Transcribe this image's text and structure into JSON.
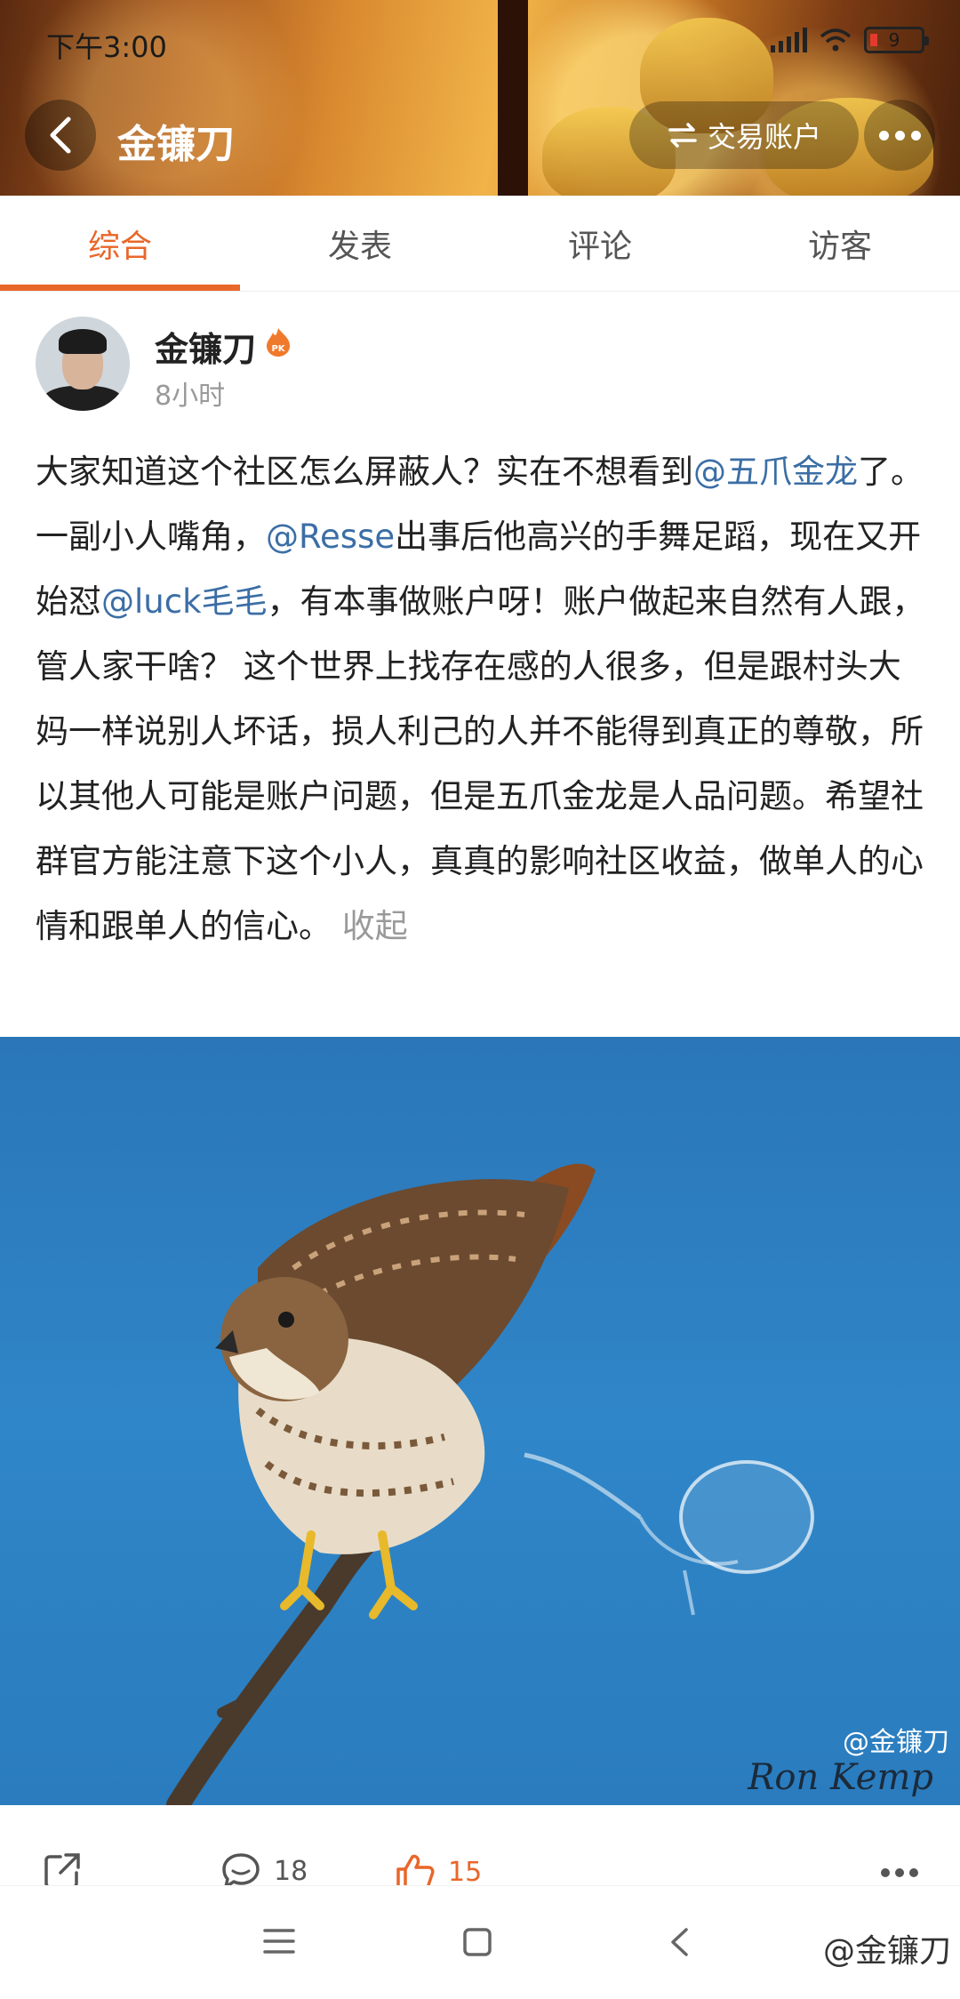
{
  "status_bar": {
    "time": "下午3:00",
    "battery": "9"
  },
  "header": {
    "title": "金镰刀",
    "trade_account_label": "交易账户"
  },
  "tabs": [
    {
      "label": "综合",
      "active": true
    },
    {
      "label": "发表",
      "active": false
    },
    {
      "label": "评论",
      "active": false
    },
    {
      "label": "访客",
      "active": false
    }
  ],
  "post": {
    "author": "金镰刀",
    "time": "8小时",
    "text": {
      "p1": "大家知道这个社区怎么屏蔽人？实在不想看到",
      "m1": "@五爪金龙",
      "p2": "了。一副小人嘴角，",
      "m2": "@Resse",
      "p3": "出事后他高兴的手舞足蹈，现在又开始怼",
      "m3": "@luck毛毛",
      "p4": "，有本事做账户呀！账户做起来自然有人跟，管人家干啥？ 这个世界上找存在感的人很多，但是跟村头大妈一样说别人坏话，损人利己的人并不能得到真正的尊敬，所以其他人可能是账户问题，但是五爪金龙是人品问题。希望社群官方能注意下这个小人，真真的影响社区收益，做单人的心情和跟单人的信心。 ",
      "fold": "收起"
    },
    "image": {
      "watermark": "@金镰刀",
      "signature": "Ron Kemp"
    },
    "comment_count": "18",
    "like_count": "15"
  },
  "footer_watermark": "@金镰刀",
  "colors": {
    "accent": "#e8672a",
    "mention": "#3b6ea5"
  }
}
